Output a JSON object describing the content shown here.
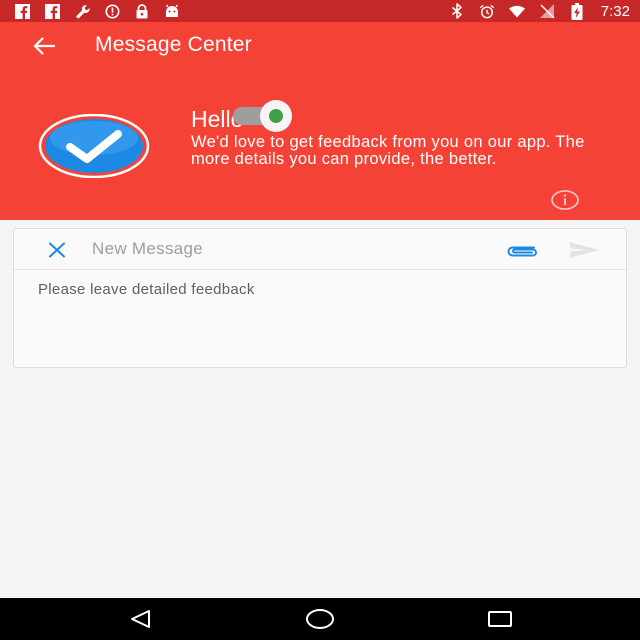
{
  "status_bar": {
    "left_icons": [
      "facebook-icon",
      "facebook-icon",
      "wrench-icon",
      "alert-circle-icon",
      "lock-icon",
      "android-icon"
    ],
    "right_icons": [
      "bluetooth-icon",
      "alarm-icon",
      "wifi-icon",
      "no-sim-icon",
      "battery-charging-icon"
    ],
    "time": "7:32",
    "color": "#c62828"
  },
  "header": {
    "title": "Message Center",
    "color": "#f44336",
    "greeting_title": "Hello",
    "greeting_body": "We'd love to get feedback from you on our app. The more details you can provide, the better.",
    "logo_icon": "checkmark-badge-icon"
  },
  "composer": {
    "title": "New Message",
    "placeholder": "Please leave detailed feedback",
    "accent": "#1e88e5"
  },
  "nav_bar": {
    "icons": [
      "back-triangle-icon",
      "home-circle-icon",
      "recents-square-icon"
    ]
  }
}
